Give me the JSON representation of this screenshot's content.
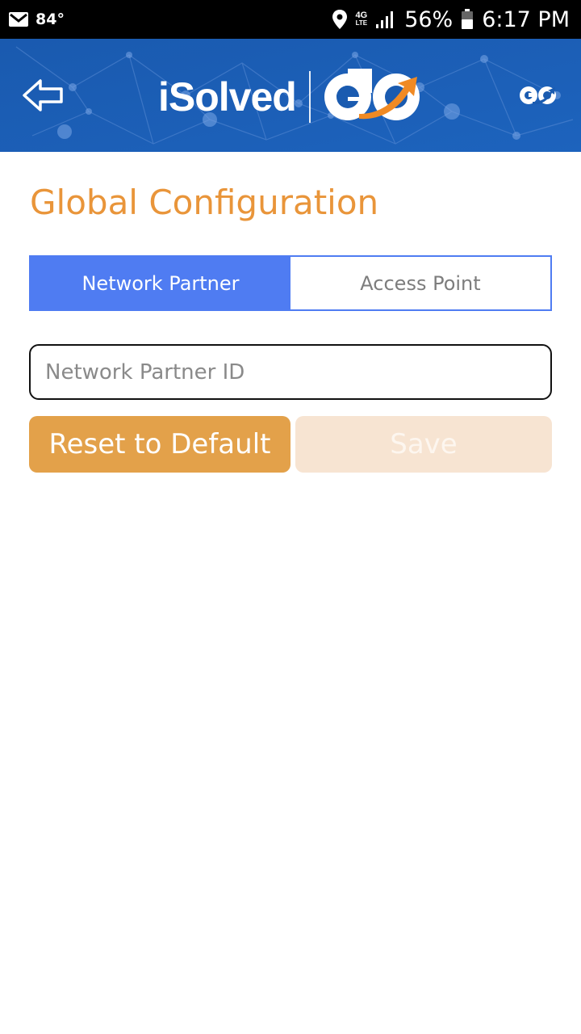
{
  "status_bar": {
    "temperature": "84°",
    "network": "4G",
    "network_sub": "LTE",
    "battery": "56%",
    "time": "6:17 PM",
    "icons": [
      "mail-icon",
      "location-icon",
      "signal-icon",
      "battery-icon"
    ]
  },
  "header": {
    "logo_text": "iSolved",
    "logo_go": "GO",
    "back_icon": "back-arrow-icon",
    "small_logo_icon": "go-logo-icon"
  },
  "page": {
    "title": "Global Configuration",
    "tabs": [
      {
        "label": "Network Partner",
        "active": true
      },
      {
        "label": "Access Point",
        "active": false
      }
    ],
    "input": {
      "placeholder": "Network Partner ID",
      "value": ""
    },
    "buttons": {
      "reset_label": "Reset to Default",
      "save_label": "Save"
    }
  },
  "colors": {
    "header_blue": "#1a5bb0",
    "accent_orange": "#e9953a",
    "tab_blue": "#4f7cf2",
    "reset_orange": "#e3a14a",
    "save_disabled": "#f7e4d2"
  }
}
